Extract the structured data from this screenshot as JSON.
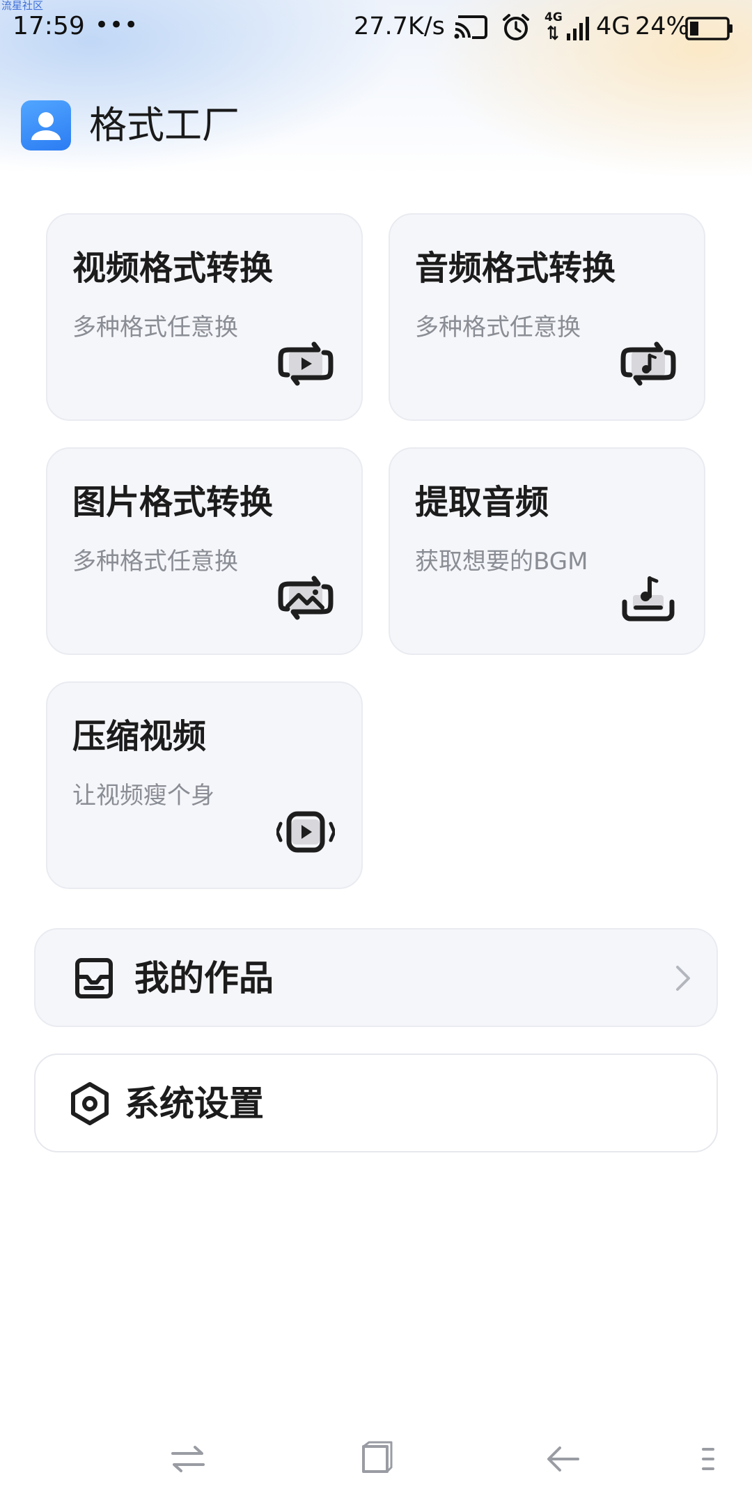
{
  "watermark": "流星社区",
  "status_bar": {
    "time": "17:59",
    "dots": "•••",
    "speed": "27.7K/s",
    "net_small": "4G",
    "network": "4G",
    "battery_pct": "24%",
    "battery_level": 0.24,
    "signal_bars": 4
  },
  "app": {
    "title": "格式工厂",
    "logo_icon": "user-icon"
  },
  "cards": [
    {
      "title": "视频格式转换",
      "subtitle": "多种格式任意换",
      "icon": "video-convert-icon"
    },
    {
      "title": "音频格式转换",
      "subtitle": "多种格式任意换",
      "icon": "audio-convert-icon"
    },
    {
      "title": "图片格式转换",
      "subtitle": "多种格式任意换",
      "icon": "image-convert-icon"
    },
    {
      "title": "提取音频",
      "subtitle": "获取想要的BGM",
      "icon": "extract-audio-icon"
    },
    {
      "title": "压缩视频",
      "subtitle": "让视频瘦个身",
      "icon": "compress-video-icon"
    }
  ],
  "rows": {
    "works": {
      "label": "我的作品",
      "icon": "inbox-icon",
      "chevron": "chevron-right-icon"
    },
    "settings": {
      "label": "系统设置",
      "icon": "settings-hexagon-icon"
    }
  },
  "nav": {
    "items": [
      "switch-icon",
      "home-square-icon",
      "back-icon",
      "menu-icon"
    ]
  },
  "colors": {
    "accent": "#2b7cf3",
    "card_bg": "#f5f6fa",
    "text_primary": "#1c1c1c",
    "text_secondary": "#8a8d94",
    "icon_dark": "#1e1e1e"
  }
}
